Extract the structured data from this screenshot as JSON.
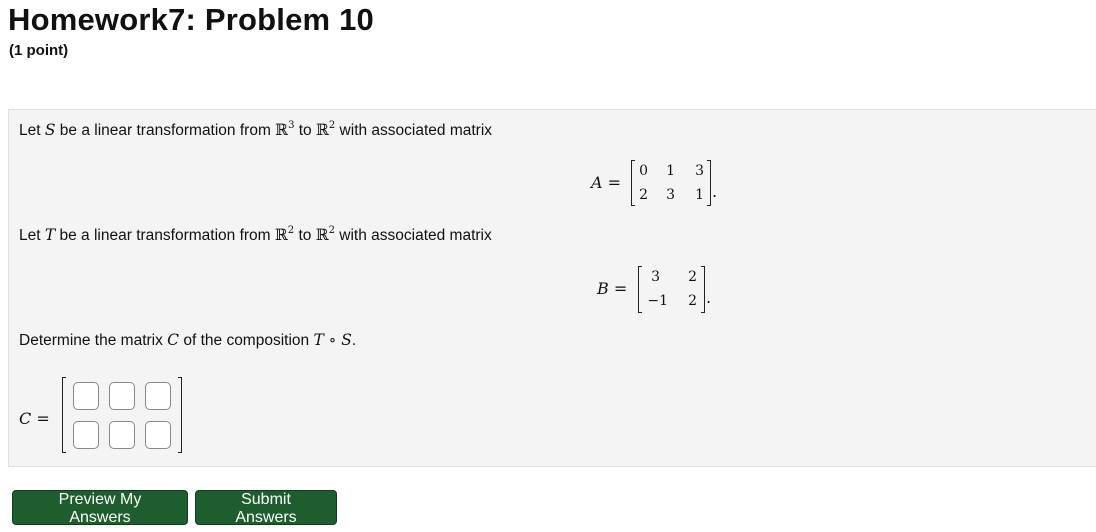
{
  "header": {
    "title": "Homework7: Problem 10",
    "points": "(1 point)"
  },
  "problem": {
    "line1_pre": "Let ",
    "line1_S": "S",
    "line1_mid": " be a linear transformation from ",
    "line1_R": "ℝ",
    "line1_exp_from": "3",
    "line1_to": " to ",
    "line1_exp_to": "2",
    "line1_post": " with associated matrix",
    "matrixA": {
      "name": "A",
      "eq": " =",
      "rows": [
        [
          "0",
          "1",
          "3"
        ],
        [
          "2",
          "3",
          "1"
        ]
      ]
    },
    "line2_pre": "Let ",
    "line2_T": "T",
    "line2_mid": " be a linear transformation from ",
    "line2_R": "ℝ",
    "line2_exp_from": "2",
    "line2_to": " to ",
    "line2_exp_to": "2",
    "line2_post": " with associated matrix",
    "matrixB": {
      "name": "B",
      "eq": " =",
      "rows": [
        [
          "3",
          "2"
        ],
        [
          "−1",
          "2"
        ]
      ]
    },
    "period": ".",
    "line3_pre": "Determine the matrix ",
    "line3_C": "C",
    "line3_mid": " of the composition ",
    "line3_comp": "T ∘ S",
    "line3_post": ".",
    "answer": {
      "label": "C =",
      "values": [
        [
          "",
          "",
          ""
        ],
        [
          "",
          "",
          ""
        ]
      ]
    }
  },
  "buttons": {
    "preview": "Preview My Answers",
    "submit": "Submit Answers"
  }
}
